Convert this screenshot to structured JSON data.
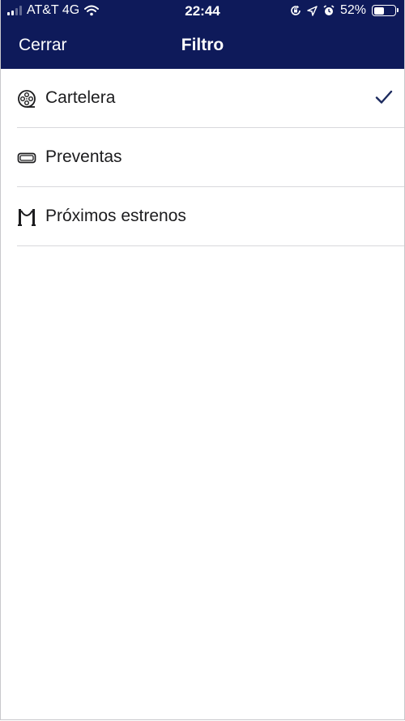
{
  "status_bar": {
    "carrier": "AT&T 4G",
    "time": "22:44",
    "battery_percent": "52%",
    "battery_level": 0.52,
    "icons": [
      "signal-icon",
      "wifi-icon",
      "orientation-lock-icon",
      "location-icon",
      "alarm-icon",
      "battery-icon"
    ]
  },
  "nav": {
    "close_label": "Cerrar",
    "title": "Filtro"
  },
  "filters": [
    {
      "label": "Cartelera",
      "icon": "film-reel-icon",
      "selected": true
    },
    {
      "label": "Preventas",
      "icon": "ticket-icon",
      "selected": false
    },
    {
      "label": "Próximos estrenos",
      "icon": "stanchion-icon",
      "selected": false
    }
  ],
  "colors": {
    "header_bg": "#0e1a5a",
    "header_text": "#ffffff",
    "checkmark": "#1c2a5e",
    "separator": "#d8d8dc"
  }
}
